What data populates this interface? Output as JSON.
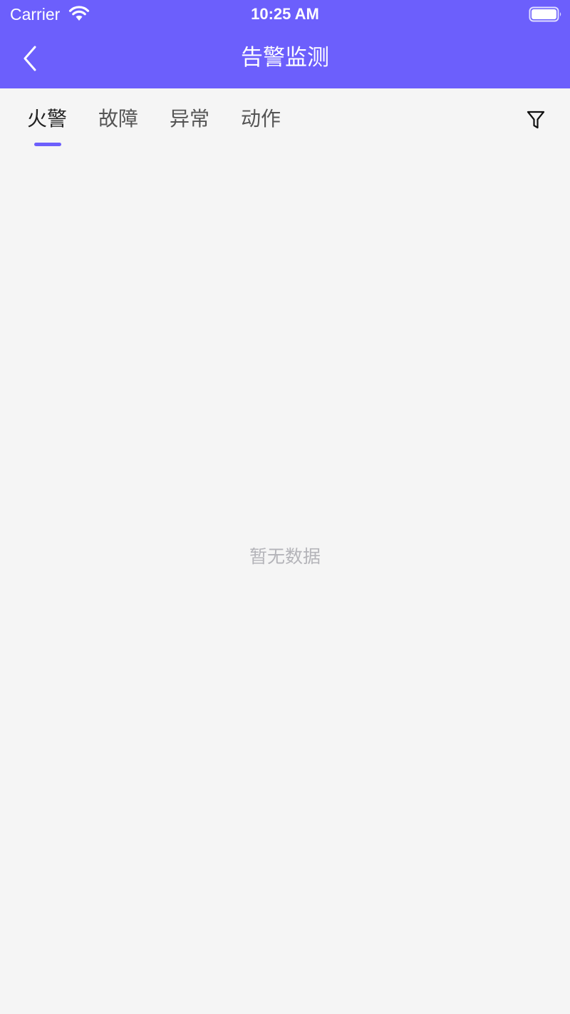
{
  "status_bar": {
    "carrier": "Carrier",
    "time": "10:25 AM"
  },
  "nav": {
    "title": "告警监测",
    "back_icon": "chevron-left-icon"
  },
  "tabs": [
    {
      "label": "火警",
      "active": true
    },
    {
      "label": "故障",
      "active": false
    },
    {
      "label": "异常",
      "active": false
    },
    {
      "label": "动作",
      "active": false
    }
  ],
  "filter_icon": "filter-icon",
  "empty_state": {
    "message": "暂无数据"
  },
  "colors": {
    "accent": "#6c5ffc",
    "background": "#f5f5f5",
    "empty_text": "#b4b4b9"
  }
}
